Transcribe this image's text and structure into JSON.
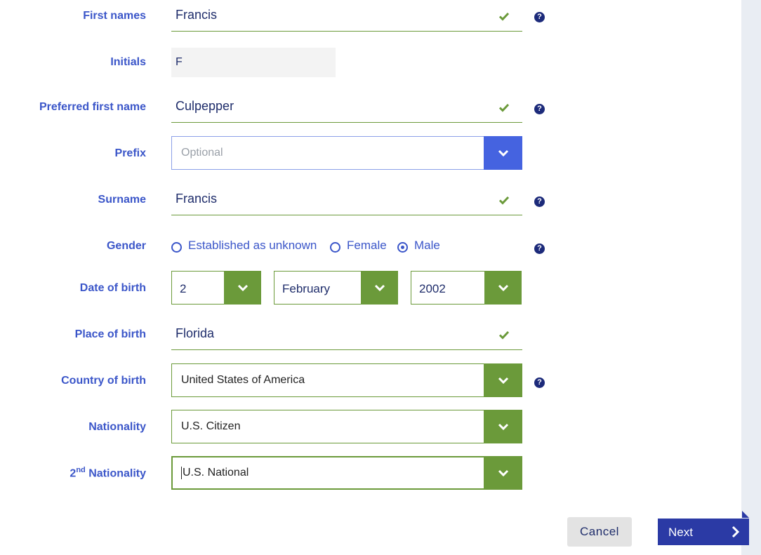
{
  "colors": {
    "label": "#3b56c9",
    "valid": "#6b9a3a",
    "primary": "#2b3aa5",
    "select_blue": "#4563e0"
  },
  "fields": {
    "first_names": {
      "label": "First names",
      "value": "Francis"
    },
    "initials": {
      "label": "Initials",
      "value": "F"
    },
    "preferred_first_name": {
      "label": "Preferred first name",
      "value": "Culpepper"
    },
    "prefix": {
      "label": "Prefix",
      "placeholder": "Optional"
    },
    "surname": {
      "label": "Surname",
      "value": "Francis"
    },
    "gender": {
      "label": "Gender",
      "options": [
        "Established as unknown",
        "Female",
        "Male"
      ],
      "selected": "Male"
    },
    "date_of_birth": {
      "label": "Date of birth",
      "day": "2",
      "month": "February",
      "year": "2002"
    },
    "place_of_birth": {
      "label": "Place of birth",
      "value": "Florida"
    },
    "country_of_birth": {
      "label": "Country of birth",
      "value": "United States of America"
    },
    "nationality": {
      "label": "Nationality",
      "value": "U.S. Citizen"
    },
    "second_nationality": {
      "label_prefix": "2",
      "label_sup": "nd",
      "label_suffix": " Nationality",
      "value": "U.S. National"
    }
  },
  "icons": {
    "valid": "checkmark-icon",
    "help": "question-circle-icon",
    "dropdown": "chevron-down-icon",
    "next": "chevron-right-icon"
  },
  "actions": {
    "cancel": "Cancel",
    "next": "Next"
  },
  "help_glyph": "?"
}
